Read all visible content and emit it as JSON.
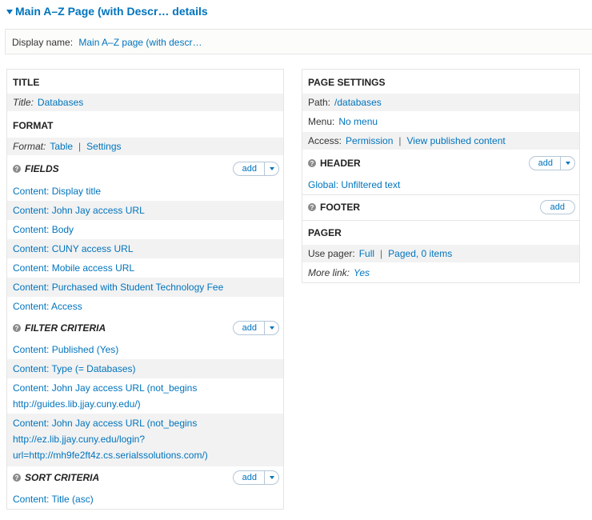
{
  "header": {
    "title": "Main A–Z Page (with Descr… details"
  },
  "display": {
    "label": "Display name:",
    "value": "Main A–Z page (with descr…"
  },
  "left": {
    "title_section": {
      "heading": "TITLE",
      "label": "Title:",
      "value": "Databases"
    },
    "format_section": {
      "heading": "FORMAT",
      "label": "Format:",
      "value": "Table",
      "settings": "Settings"
    },
    "fields": {
      "heading": "FIELDS",
      "add_label": "add",
      "items": [
        "Content: Display title",
        "Content: John Jay access URL",
        "Content: Body",
        "Content: CUNY access URL",
        "Content: Mobile access URL",
        "Content: Purchased with Student Technology Fee",
        "Content: Access"
      ]
    },
    "filter": {
      "heading": "FILTER CRITERIA",
      "add_label": "add",
      "items": [
        "Content: Published (Yes)",
        "Content: Type (= Databases)"
      ],
      "item3_lines": [
        "Content: John Jay access URL (not_begins",
        "http://guides.lib.jjay.cuny.edu/)"
      ],
      "item4_lines": [
        "Content: John Jay access URL (not_begins",
        "http://ez.lib.jjay.cuny.edu/login?",
        "url=http://mh9fe2ft4z.cs.serialssolutions.com/)"
      ]
    },
    "sort": {
      "heading": "SORT CRITERIA",
      "add_label": "add",
      "items": [
        "Content: Title (asc)"
      ]
    }
  },
  "right": {
    "page_settings": {
      "heading": "PAGE SETTINGS",
      "path_label": "Path:",
      "path_value": "/databases",
      "menu_label": "Menu:",
      "menu_value": "No menu",
      "access_label": "Access:",
      "access_value": "Permission",
      "access_link2": "View published content"
    },
    "header_section": {
      "heading": "HEADER",
      "add_label": "add",
      "item": "Global: Unfiltered text"
    },
    "footer_section": {
      "heading": "FOOTER",
      "add_label": "add"
    },
    "pager": {
      "heading": "PAGER",
      "use_label": "Use pager:",
      "use_value": "Full",
      "use_value2": "Paged, 0 items",
      "more_label": "More link:",
      "more_value": "Yes"
    }
  }
}
